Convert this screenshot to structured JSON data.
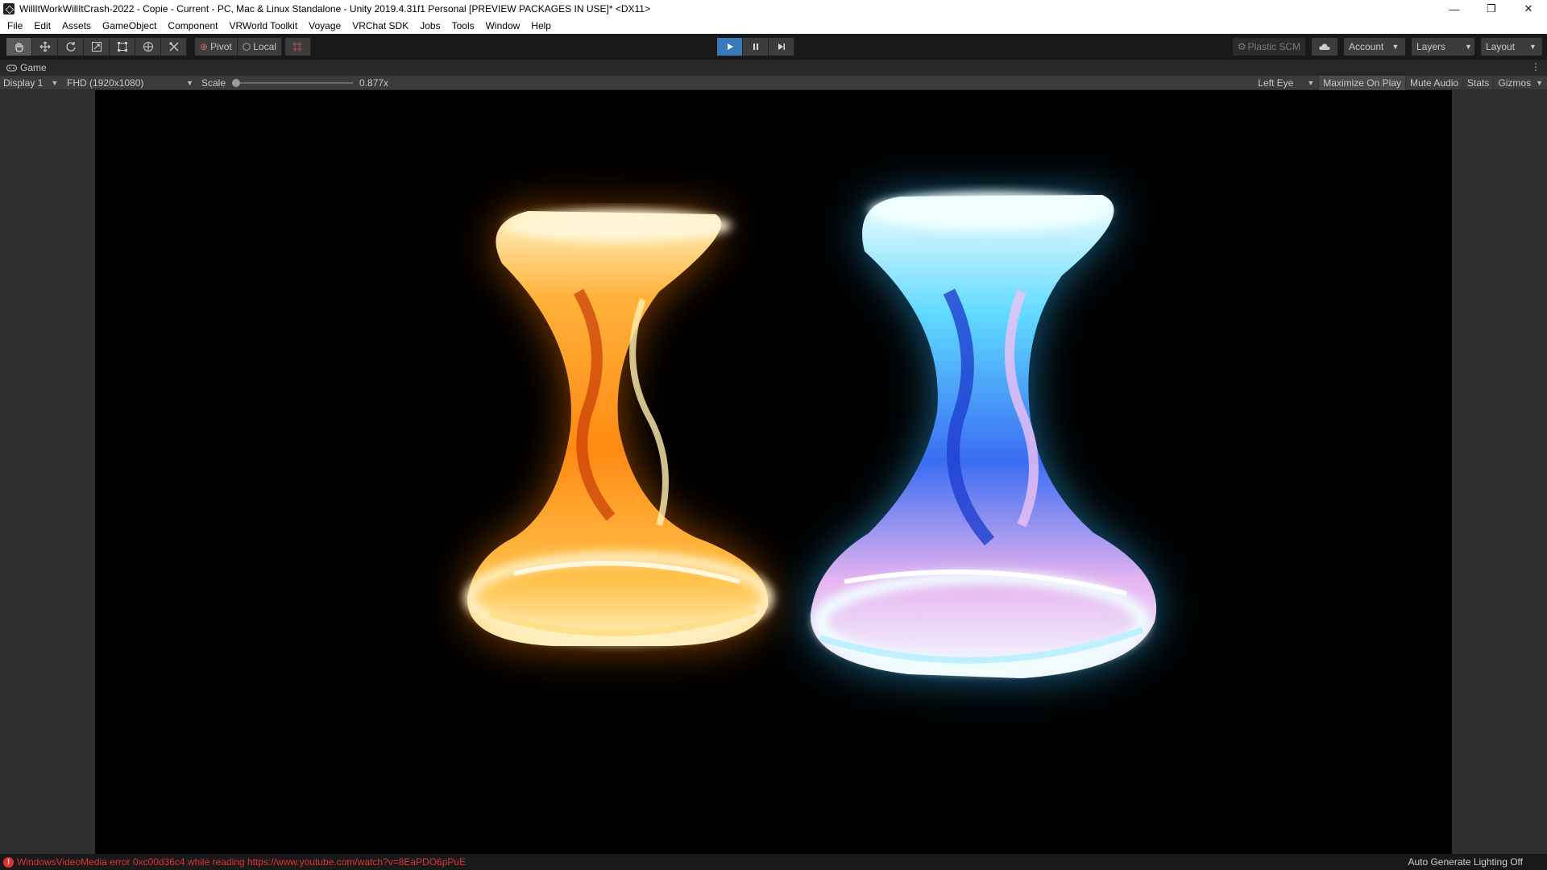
{
  "window": {
    "title": "WillItWorkWillItCrash-2022 - Copie - Current - PC, Mac & Linux Standalone - Unity 2019.4.31f1 Personal [PREVIEW PACKAGES IN USE]* <DX11>",
    "minimize": "—",
    "restore": "❐",
    "close": "✕"
  },
  "menu": [
    "File",
    "Edit",
    "Assets",
    "GameObject",
    "Component",
    "VRWorld Toolkit",
    "Voyage",
    "VRChat SDK",
    "Jobs",
    "Tools",
    "Window",
    "Help"
  ],
  "toolbar": {
    "pivot_label": "Pivot",
    "local_label": "Local",
    "plastic_label": "Plastic SCM",
    "account_label": "Account",
    "layers_label": "Layers",
    "layout_label": "Layout"
  },
  "tab": {
    "label": "Game"
  },
  "gamebar": {
    "display": "Display 1",
    "resolution": "FHD (1920x1080)",
    "scale_label": "Scale",
    "scale_value": "0.877x",
    "eye": "Left Eye",
    "maximize": "Maximize On Play",
    "mute": "Mute Audio",
    "stats": "Stats",
    "gizmos": "Gizmos"
  },
  "status": {
    "error": "WindowsVideoMedia error 0xc00d36c4 while reading https://www.youtube.com/watch?v=8EaPDO6pPuE",
    "right": "Auto Generate Lighting Off"
  },
  "colors": {
    "accent": "#3a79bb",
    "error": "#dd3333",
    "fire": "#ff9a1a",
    "ice": "#4fd8ff"
  }
}
